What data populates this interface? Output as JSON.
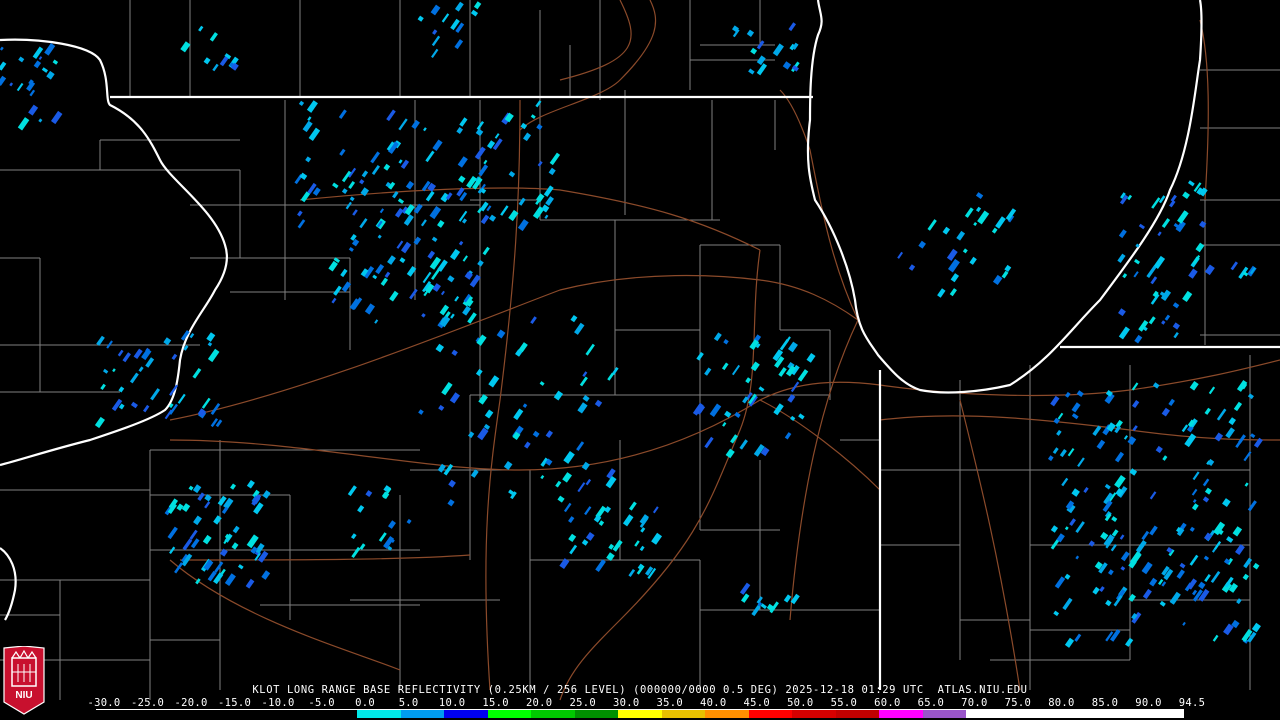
{
  "product_title": "KLOT LONG RANGE BASE REFLECTIVITY (0.25KM / 256 LEVEL) (000000/0000 0.5 DEG) 2025-12-18 01:29 UTC  ATLAS.NIU.EDU",
  "logo_text": "NIU",
  "scale_labels": [
    "-30.0",
    "-25.0",
    "-20.0",
    "-15.0",
    "-10.0",
    "-5.0",
    "0.0",
    "5.0",
    "10.0",
    "15.0",
    "20.0",
    "25.0",
    "30.0",
    "35.0",
    "40.0",
    "45.0",
    "50.0",
    "55.0",
    "60.0",
    "65.0",
    "70.0",
    "75.0",
    "80.0",
    "85.0",
    "90.0",
    "94.5"
  ],
  "colorbar_colors": [
    "#000000",
    "#000000",
    "#000000",
    "#000000",
    "#000000",
    "#000000",
    "#00e8e8",
    "#009cf0",
    "#0000f0",
    "#00ff00",
    "#00c800",
    "#009000",
    "#ffff00",
    "#e7c000",
    "#ff9000",
    "#ff0000",
    "#d60000",
    "#c00000",
    "#ff00ff",
    "#9955c9",
    "#ffffff",
    "#ffffff",
    "#ffffff",
    "#ffffff",
    "#ffffff"
  ],
  "echo_colors": [
    "#00c8f0",
    "#00a8e8",
    "#0070e0",
    "#1a5ae6",
    "#00e0e0"
  ]
}
